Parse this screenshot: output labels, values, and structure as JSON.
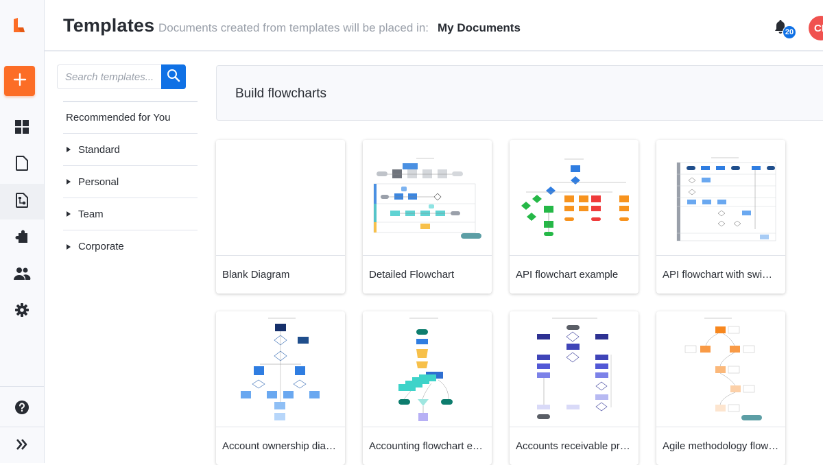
{
  "app": {
    "brand_color": "#fc6d26",
    "accent_color": "#1071e5"
  },
  "rail": {
    "logo": "lucid-logo-icon",
    "new_button": {
      "icon": "plus-icon",
      "label": "New"
    },
    "items": [
      {
        "id": "dashboard",
        "icon": "grid-icon",
        "active": false
      },
      {
        "id": "documents",
        "icon": "document-icon",
        "active": false
      },
      {
        "id": "templates",
        "icon": "template-document-icon",
        "active": true
      },
      {
        "id": "integrations",
        "icon": "puzzle-piece-icon",
        "active": false
      },
      {
        "id": "team",
        "icon": "users-icon",
        "active": false
      },
      {
        "id": "settings",
        "icon": "gear-icon",
        "active": false
      }
    ],
    "help_icon": "question-circle-icon",
    "expand_icon": "double-chevron-right-icon"
  },
  "header": {
    "title": "Templates",
    "subtitle": "Documents created from templates will be placed in:",
    "folder": "My Documents",
    "notifications_count": "20",
    "avatar_initials": "CH"
  },
  "sidebar": {
    "search": {
      "placeholder": "Search templates...",
      "value": ""
    },
    "recommended_label": "Recommended for You",
    "categories": [
      {
        "label": "Standard",
        "expanded": false
      },
      {
        "label": "Personal",
        "expanded": false
      },
      {
        "label": "Team",
        "expanded": false
      },
      {
        "label": "Corporate",
        "expanded": false
      }
    ]
  },
  "main": {
    "section_title": "Build flowcharts",
    "templates": [
      {
        "name": "Blank Diagram",
        "thumbnail": "blank"
      },
      {
        "name": "Detailed Flowchart",
        "thumbnail": "swimlane-flowchart"
      },
      {
        "name": "API flowchart example",
        "thumbnail": "api-flowchart"
      },
      {
        "name": "API flowchart with swimlanes",
        "thumbnail": "api-swimlane-flowchart"
      },
      {
        "name": "Account ownership diagram",
        "thumbnail": "account-ownership"
      },
      {
        "name": "Accounting flowchart example",
        "thumbnail": "accounting-flowchart"
      },
      {
        "name": "Accounts receivable process",
        "thumbnail": "accounts-receivable"
      },
      {
        "name": "Agile methodology flowchart",
        "thumbnail": "agile-flowchart"
      }
    ]
  }
}
